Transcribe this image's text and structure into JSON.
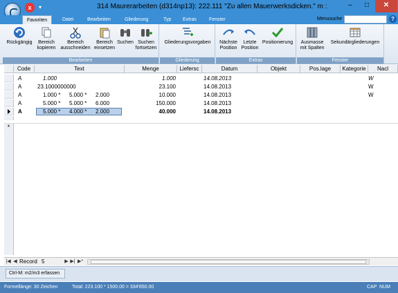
{
  "window": {
    "title": "314 Maurerarbeiten (d314np13): 222.111    \"Zu allen Mauerwerksdicken.\" m  :",
    "qat_close": "x",
    "qat_dropdown": "▾",
    "controls": {
      "minimize": "–",
      "maximize": "□",
      "close": "✕"
    }
  },
  "tabs": [
    "Favoriten",
    "Datei",
    "Bearbeiten",
    "Gliederung",
    "Typ",
    "Extras",
    "Fenster"
  ],
  "menusuche": {
    "label": "Menusuche",
    "value": ""
  },
  "help": "?",
  "ribbon": {
    "groups": [
      {
        "label": "Bearbeiten",
        "buttons": [
          {
            "label1": "Rückgängig",
            "label2": ""
          },
          {
            "label1": "Bereich",
            "label2": "kopieren"
          },
          {
            "label1": "Bereich",
            "label2": "ausschneiden"
          },
          {
            "label1": "Bereich",
            "label2": "einsetzen"
          },
          {
            "label1": "Suchen",
            "label2": ""
          },
          {
            "label1": "Suchen",
            "label2": "fortsetzen"
          }
        ]
      },
      {
        "label": "Gliederung",
        "buttons": [
          {
            "label1": "Gliederungsvorgaben",
            "label2": ""
          }
        ]
      },
      {
        "label": "Extras",
        "buttons": [
          {
            "label1": "Nächste",
            "label2": "Position"
          },
          {
            "label1": "Letzte",
            "label2": "Position"
          },
          {
            "label1": "Positionierung",
            "label2": ""
          }
        ]
      },
      {
        "label": "Fenster",
        "buttons": [
          {
            "label1": "Ausmasse",
            "label2": "mit Spalten"
          },
          {
            "label1": "Sekundärgliederungen",
            "label2": ""
          }
        ]
      }
    ]
  },
  "grid": {
    "columns": [
      "Code",
      "Text",
      "Menge",
      "Liefersc",
      "Datum",
      "Objekt",
      "Pos.lage",
      "Kategorie",
      "Nacl"
    ],
    "rows": [
      {
        "code": "A",
        "t1": "1.000",
        "t2": "",
        "t3": "",
        "menge": "1.000",
        "datum": "14.08.2013",
        "kategorie": "W",
        "style": "italic"
      },
      {
        "code": "A",
        "t1": "23.1000000000",
        "t2": "",
        "t3": "",
        "menge": "23.100",
        "datum": "14.08.2013",
        "kategorie": "W",
        "style": "normal"
      },
      {
        "code": "A",
        "t1": "1.000 *",
        "t2": "5.000 *",
        "t3": "2.000",
        "menge": "10.000",
        "datum": "14.08.2013",
        "kategorie": "W",
        "style": "normal"
      },
      {
        "code": "A",
        "t1": "5.000 *",
        "t2": "5.000 *",
        "t3": "6.000",
        "menge": "150.000",
        "datum": "14.08.2013",
        "kategorie": "",
        "style": "normal"
      },
      {
        "code": "A",
        "t1": "5.000 *",
        "t2": "4.000 *",
        "t3": "2.000",
        "menge": "40.000",
        "datum": "14.08.2013",
        "kategorie": "",
        "style": "bold"
      }
    ],
    "new_row_marker": "*"
  },
  "navigator": {
    "label": "Record",
    "value": "5",
    "first": "|◀",
    "prev": "◀",
    "next": "▶",
    "last": "▶|",
    "new": "▶*"
  },
  "shortcut": "Ctrl-M: m2/m3 erfassen",
  "status": {
    "formel": "Formellänge: 30 Zeichen",
    "total": "Total: 223.100 * 1500.00 = 334'650.00",
    "caps": "CAP",
    "num": "NUM"
  },
  "colors": {
    "titlebar": "#3a8fd6",
    "ribbon_label": "#7fa2c6",
    "selection": "#b8d0ec",
    "statusbar": "#4a7fb8"
  }
}
